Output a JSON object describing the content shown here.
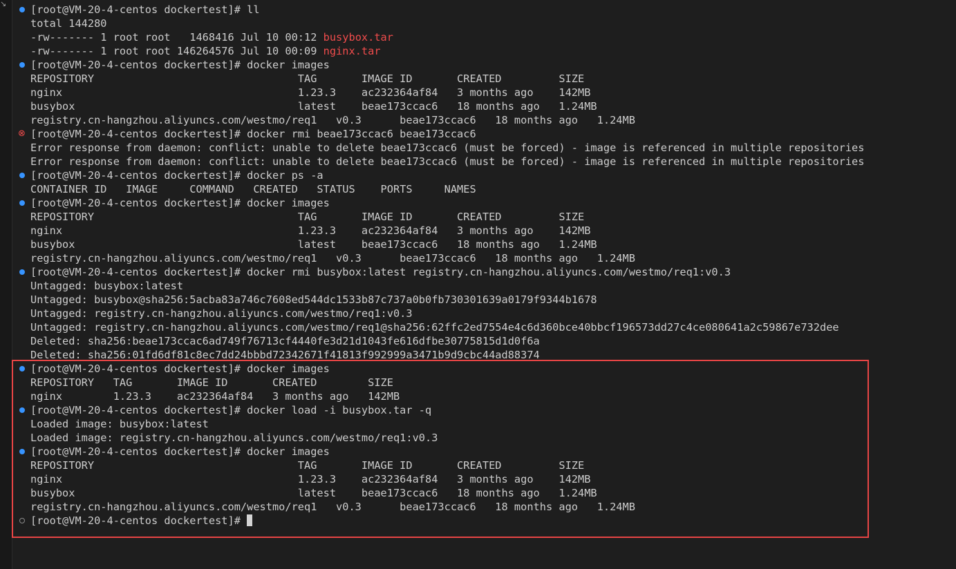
{
  "prompt": "[root@VM-20-4-centos dockertest]#",
  "lines": [
    {
      "kind": "cmd",
      "status": "success",
      "cmd": " ll"
    },
    {
      "kind": "out",
      "text": "total 144280"
    },
    {
      "kind": "out",
      "text": "-rw------- 1 root root   1468416 Jul 10 00:12 ",
      "accent": "busybox.tar"
    },
    {
      "kind": "out",
      "text": "-rw------- 1 root root 146264576 Jul 10 00:09 ",
      "accent": "nginx.tar"
    },
    {
      "kind": "cmd",
      "status": "success",
      "cmd": " docker images"
    },
    {
      "kind": "out",
      "text": "REPOSITORY                                TAG       IMAGE ID       CREATED         SIZE"
    },
    {
      "kind": "out",
      "text": "nginx                                     1.23.3    ac232364af84   3 months ago    142MB"
    },
    {
      "kind": "out",
      "text": "busybox                                   latest    beae173ccac6   18 months ago   1.24MB"
    },
    {
      "kind": "out",
      "text": "registry.cn-hangzhou.aliyuncs.com/westmo/req1   v0.3      beae173ccac6   18 months ago   1.24MB"
    },
    {
      "kind": "cmd",
      "status": "error",
      "cmd": " docker rmi beae173ccac6 beae173ccac6"
    },
    {
      "kind": "out",
      "text": "Error response from daemon: conflict: unable to delete beae173ccac6 (must be forced) - image is referenced in multiple repositories"
    },
    {
      "kind": "out",
      "text": "Error response from daemon: conflict: unable to delete beae173ccac6 (must be forced) - image is referenced in multiple repositories"
    },
    {
      "kind": "cmd",
      "status": "success",
      "cmd": " docker ps -a"
    },
    {
      "kind": "out",
      "text": "CONTAINER ID   IMAGE     COMMAND   CREATED   STATUS    PORTS     NAMES"
    },
    {
      "kind": "cmd",
      "status": "success",
      "cmd": " docker images"
    },
    {
      "kind": "out",
      "text": "REPOSITORY                                TAG       IMAGE ID       CREATED         SIZE"
    },
    {
      "kind": "out",
      "text": "nginx                                     1.23.3    ac232364af84   3 months ago    142MB"
    },
    {
      "kind": "out",
      "text": "busybox                                   latest    beae173ccac6   18 months ago   1.24MB"
    },
    {
      "kind": "out",
      "text": "registry.cn-hangzhou.aliyuncs.com/westmo/req1   v0.3      beae173ccac6   18 months ago   1.24MB"
    },
    {
      "kind": "cmd",
      "status": "success",
      "cmd": " docker rmi busybox:latest registry.cn-hangzhou.aliyuncs.com/westmo/req1:v0.3"
    },
    {
      "kind": "out",
      "text": "Untagged: busybox:latest"
    },
    {
      "kind": "out",
      "text": "Untagged: busybox@sha256:5acba83a746c7608ed544dc1533b87c737a0b0fb730301639a0179f9344b1678"
    },
    {
      "kind": "out",
      "text": "Untagged: registry.cn-hangzhou.aliyuncs.com/westmo/req1:v0.3"
    },
    {
      "kind": "out",
      "text": "Untagged: registry.cn-hangzhou.aliyuncs.com/westmo/req1@sha256:62ffc2ed7554e4c6d360bce40bbcf196573dd27c4ce080641a2c59867e732dee"
    },
    {
      "kind": "out",
      "text": "Deleted: sha256:beae173ccac6ad749f76713cf4440fe3d21d1043fe616dfbe30775815d1d0f6a"
    },
    {
      "kind": "out",
      "text": "Deleted: sha256:01fd6df81c8ec7dd24bbbd72342671f41813f992999a3471b9d9cbc44ad88374"
    },
    {
      "kind": "cmd",
      "status": "success",
      "cmd": " docker images"
    },
    {
      "kind": "out",
      "text": "REPOSITORY   TAG       IMAGE ID       CREATED        SIZE"
    },
    {
      "kind": "out",
      "text": "nginx        1.23.3    ac232364af84   3 months ago   142MB"
    },
    {
      "kind": "cmd",
      "status": "success",
      "cmd": " docker load -i busybox.tar -q"
    },
    {
      "kind": "out",
      "text": "Loaded image: busybox:latest"
    },
    {
      "kind": "out",
      "text": "Loaded image: registry.cn-hangzhou.aliyuncs.com/westmo/req1:v0.3"
    },
    {
      "kind": "cmd",
      "status": "success",
      "cmd": " docker images"
    },
    {
      "kind": "out",
      "text": "REPOSITORY                                TAG       IMAGE ID       CREATED         SIZE"
    },
    {
      "kind": "out",
      "text": "nginx                                     1.23.3    ac232364af84   3 months ago    142MB"
    },
    {
      "kind": "out",
      "text": "busybox                                   latest    beae173ccac6   18 months ago   1.24MB"
    },
    {
      "kind": "out",
      "text": "registry.cn-hangzhou.aliyuncs.com/westmo/req1   v0.3      beae173ccac6   18 months ago   1.24MB"
    },
    {
      "kind": "cmd",
      "status": "pending",
      "cmd": " ",
      "cursor": true
    }
  ],
  "colors": {
    "background": "#1e1e1e",
    "text": "#cccccc",
    "accent_red": "#f14c4c",
    "success_dot": "#3794ff",
    "highlight_border": "#e84545"
  },
  "icons": {
    "success": "circle-filled-icon",
    "error": "circle-x-icon",
    "pending": "circle-outline-icon"
  }
}
